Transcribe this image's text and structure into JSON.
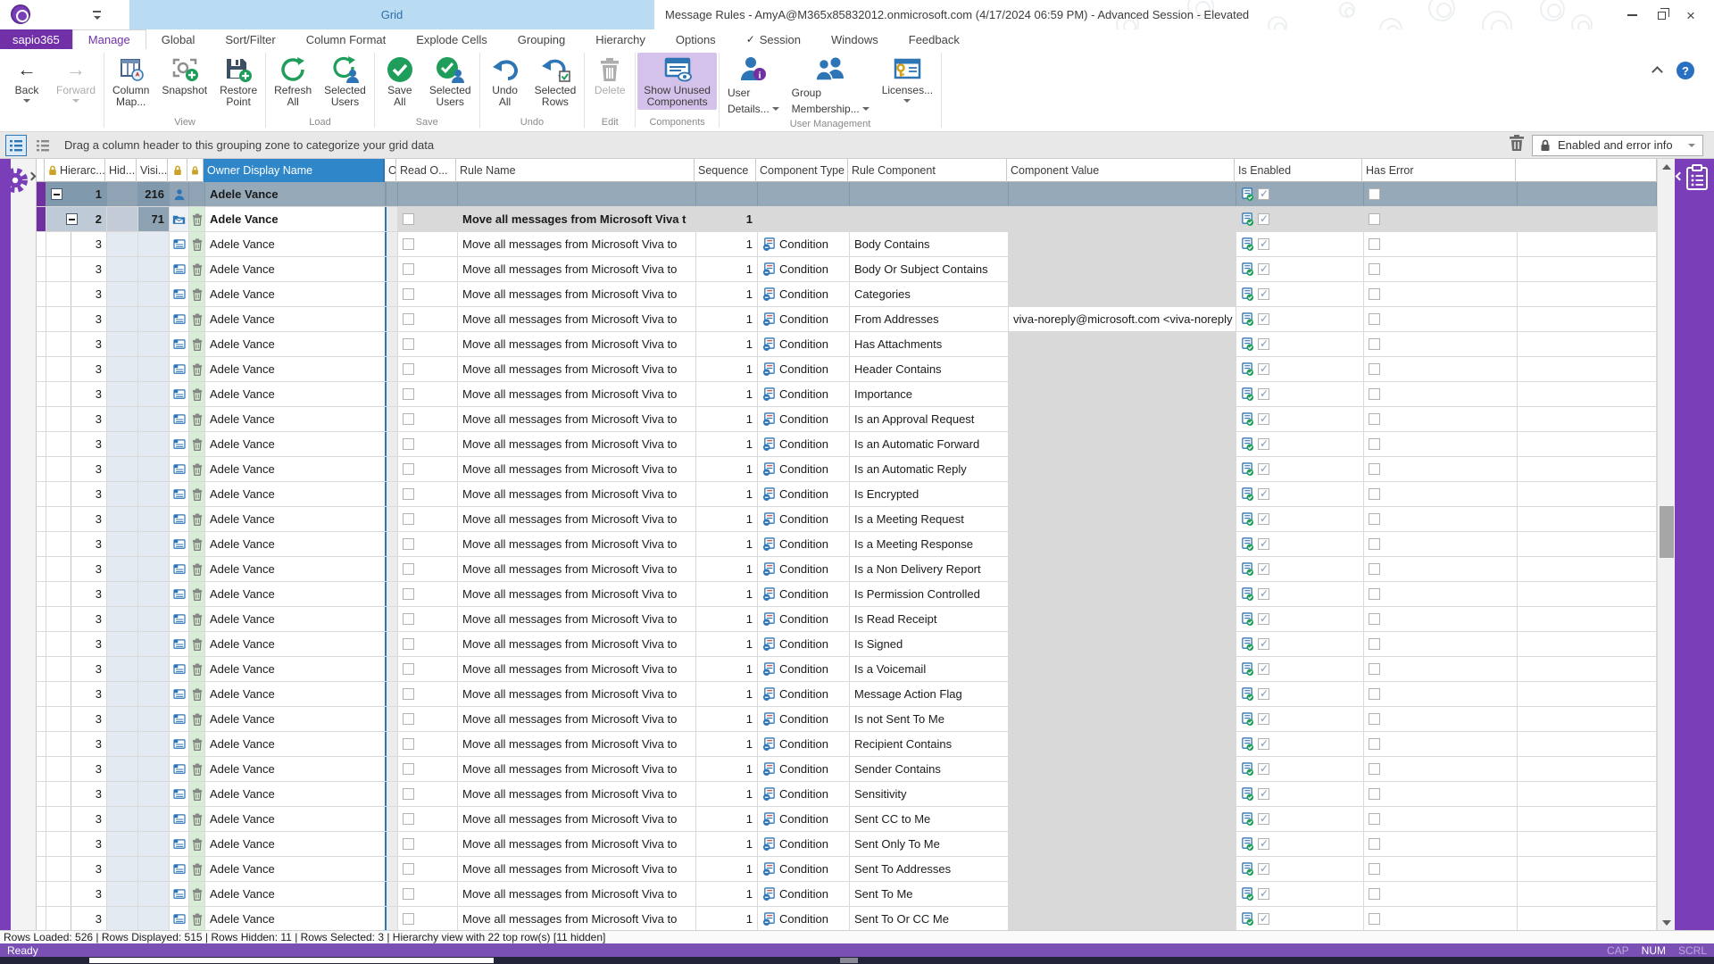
{
  "titlebar": {
    "context_tab": "Grid",
    "title": "Message Rules - AmyA@M365x85832012.onmicrosoft.com (4/17/2024 06:59 PM) - Advanced Session - Elevated"
  },
  "tabs": {
    "app": "sapio365",
    "items": [
      "Manage",
      "Global",
      "Sort/Filter",
      "Column Format",
      "Explode Cells",
      "Grouping",
      "Hierarchy",
      "Options",
      "Session",
      "Windows",
      "Feedback"
    ],
    "active": "Manage"
  },
  "ribbon": {
    "back": "Back",
    "forward": "Forward",
    "view": {
      "label": "View",
      "column_map": "Column\nMap...",
      "snapshot": "Snapshot",
      "restore_point": "Restore\nPoint"
    },
    "load": {
      "label": "Load",
      "refresh_all": "Refresh\nAll",
      "selected_users": "Selected\nUsers"
    },
    "save": {
      "label": "Save",
      "save_all": "Save\nAll",
      "selected_users": "Selected\nUsers"
    },
    "undo": {
      "label": "Undo",
      "undo_all": "Undo\nAll",
      "selected_rows": "Selected\nRows"
    },
    "edit": {
      "label": "Edit",
      "delete": "Delete"
    },
    "components": {
      "label": "Components",
      "show_unused": "Show Unused\nComponents"
    },
    "user_management": {
      "label": "User Management",
      "user_details": "User\nDetails...",
      "group_membership": "Group\nMembership...",
      "licenses": "Licenses..."
    }
  },
  "grouping_bar": {
    "text": "Drag a column header to this grouping zone to categorize your grid data",
    "view_filter": "Enabled and error info"
  },
  "grid": {
    "headers": {
      "hierarchy": "Hierarc...",
      "hidden": "Hid...",
      "visible": "Visi...",
      "owner": "Owner Display Name",
      "o": "O...",
      "read_o": "Read O...",
      "rule_name": "Rule Name",
      "sequence": "Sequence",
      "component_type": "Component Type",
      "rule_component": "Rule Component",
      "component_value": "Component Value",
      "is_enabled": "Is Enabled",
      "has_error": "Has Error"
    },
    "group_rows": [
      {
        "level": 1,
        "hier": "1",
        "visible": "216",
        "owner": "Adele Vance"
      },
      {
        "level": 2,
        "hier": "2",
        "visible": "71",
        "owner": "Adele Vance",
        "rule_name": "Move all messages from Microsoft Viva t",
        "sequence": "1"
      }
    ],
    "detail_row": {
      "hier": "3",
      "owner": "Adele Vance",
      "rule_name": "Move all messages from Microsoft Viva to",
      "sequence": "1",
      "component_type": "Condition"
    },
    "rows": [
      {
        "rule_component": "Body Contains",
        "component_value": ""
      },
      {
        "rule_component": "Body Or Subject Contains",
        "component_value": ""
      },
      {
        "rule_component": "Categories",
        "component_value": ""
      },
      {
        "rule_component": "From Addresses",
        "component_value": "viva-noreply@microsoft.com <viva-noreply"
      },
      {
        "rule_component": "Has Attachments",
        "component_value": ""
      },
      {
        "rule_component": "Header Contains",
        "component_value": ""
      },
      {
        "rule_component": "Importance",
        "component_value": ""
      },
      {
        "rule_component": "Is an Approval Request",
        "component_value": ""
      },
      {
        "rule_component": "Is an Automatic Forward",
        "component_value": ""
      },
      {
        "rule_component": "Is an Automatic Reply",
        "component_value": ""
      },
      {
        "rule_component": "Is Encrypted",
        "component_value": ""
      },
      {
        "rule_component": "Is a Meeting Request",
        "component_value": ""
      },
      {
        "rule_component": "Is a Meeting Response",
        "component_value": ""
      },
      {
        "rule_component": "Is a Non Delivery Report",
        "component_value": ""
      },
      {
        "rule_component": "Is Permission Controlled",
        "component_value": ""
      },
      {
        "rule_component": "Is Read Receipt",
        "component_value": ""
      },
      {
        "rule_component": "Is Signed",
        "component_value": ""
      },
      {
        "rule_component": "Is a Voicemail",
        "component_value": ""
      },
      {
        "rule_component": "Message Action Flag",
        "component_value": ""
      },
      {
        "rule_component": "Is not Sent To Me",
        "component_value": ""
      },
      {
        "rule_component": "Recipient Contains",
        "component_value": ""
      },
      {
        "rule_component": "Sender Contains",
        "component_value": ""
      },
      {
        "rule_component": "Sensitivity",
        "component_value": ""
      },
      {
        "rule_component": "Sent CC to Me",
        "component_value": ""
      },
      {
        "rule_component": "Sent Only To Me",
        "component_value": ""
      },
      {
        "rule_component": "Sent To Addresses",
        "component_value": ""
      },
      {
        "rule_component": "Sent To Me",
        "component_value": ""
      },
      {
        "rule_component": "Sent To Or CC Me",
        "component_value": ""
      }
    ]
  },
  "status": {
    "info": "Rows Loaded: 526 | Rows Displayed: 515 | Rows Hidden: 11 | Rows Selected: 3 | Hierarchy view with 22 top row(s) [11 hidden]",
    "ready": "Ready",
    "cap": "CAP",
    "num": "NUM",
    "scrl": "SCRL"
  },
  "icons": {
    "lock": "gold-lock",
    "trash": "trash-can",
    "person": "blue-person",
    "gear": "purple-gear",
    "clipboard": "white-clipboard",
    "help": "question-circle",
    "condition": "rule-condition-sheet",
    "enabled": "sheet-green-check"
  },
  "colors": {
    "brand_purple": "#7130a8",
    "rail_purple": "#7a3fb8",
    "status_purple": "#7a50b4",
    "selected_header_blue": "#2f86c9",
    "frozen_divider_blue": "#2e75b6",
    "icon_green": "#1f9d5b",
    "icon_blue": "#2e75b6",
    "lock_gold": "#c9a227",
    "group_row_blue": "#95a9b9",
    "context_tab_blue": "#b9dcf3",
    "trash_cell_green": "#d8edd5"
  }
}
